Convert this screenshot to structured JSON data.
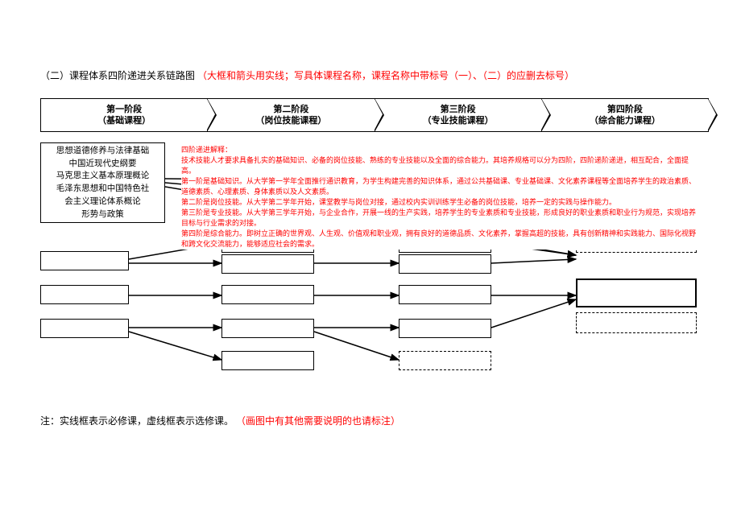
{
  "title": {
    "prefix": "（二）课程体系四阶递进关系链路图",
    "note": "（大框和箭头用实线；写具体课程名称，课程名称中带标号（一）、（二）的应删去标号）"
  },
  "stages": [
    {
      "name": "第一阶段",
      "sub": "（基础课程）"
    },
    {
      "name": "第二阶段",
      "sub": "（岗位技能课程）"
    },
    {
      "name": "第三阶段",
      "sub": "（专业技能课程）"
    },
    {
      "name": "第四阶段",
      "sub": "（综合能力课程）"
    }
  ],
  "col1_textbox": [
    "思想道德修养与法律基础",
    "中国近现代史纲要",
    "马克思主义基本原理概论",
    "毛泽东思想和中国特色社",
    "会主义理论体系概论",
    "形势与政策"
  ],
  "explanation": {
    "heading": "四阶递进解释：",
    "lines": [
      "技术技能人才要求具备扎实的基础知识、必备的岗位技能、熟练的专业技能以及全面的综合能力。其培养规格可以分为四阶，四阶递阶递进，相互配合，全面提高。",
      "第一阶是基础知识。从大学第一学年全面推行通识教育，为学生构建完善的知识体系，通过公共基础课、专业基础课、文化素养课程等全面培养学生的政治素质、道德素质、心理素质、身体素质以及人文素质。",
      "第二阶是岗位技能。从大学第二学年开始，课堂教学与岗位对接，通过校内实训训练学生必备的岗位技能，培养一定的实践与操作能力。",
      "第三阶是专业技能。从大学第三学年开始，与企业合作，开展一线的生产实践，培养学生的专业素质和专业技能，形成良好的职业素质和职业行为规范，实现培养目标与行业需求的对接。",
      "第四阶是综合能力。即树立正确的世界观、人生观、价值观和职业观，拥有良好的道德品质、文化素养，掌握高超的技能，具有创新精神和实践能力、国际化视野和跨文化交流能力，能够适应社会的需求。"
    ]
  },
  "footnote": {
    "black": "注：实线框表示必修课，虚线框表示选修课。",
    "red": "（画图中有其他需要说明的也请标注）"
  }
}
